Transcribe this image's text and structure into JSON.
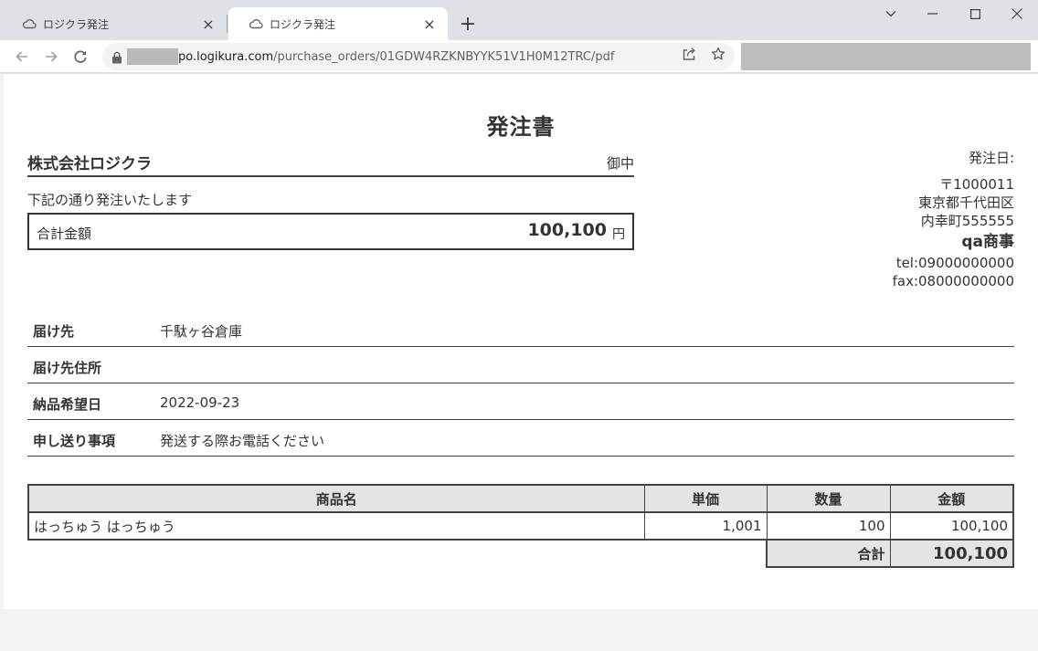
{
  "browser": {
    "tabs": [
      {
        "title": "ロジクラ発注",
        "close": "×"
      },
      {
        "title": "ロジクラ発注",
        "close": "×"
      }
    ],
    "new_tab": "+",
    "url_host": "po.logikura.com",
    "url_path": "/purchase_orders/01GDW4RZKNBYYK51V1H0M12TRC/pdf",
    "icons": {
      "tab": "cloud-icon",
      "back": "back-arrow-icon",
      "forward": "forward-arrow-icon",
      "reload": "reload-icon",
      "lock": "lock-icon",
      "share": "share-icon",
      "bookmark": "star-icon"
    }
  },
  "document": {
    "title": "発注書",
    "addressee": {
      "company": "株式会社ロジクラ",
      "honorific": "御中"
    },
    "intro": "下記の通り発注いたします",
    "total": {
      "label": "合計金額",
      "amount": "100,100",
      "unit": "円"
    },
    "issuer": {
      "order_date_label": "発注日:",
      "postal": "〒1000011",
      "address1": "東京都千代田区",
      "address2": "内幸町555555",
      "name": "qa商事",
      "tel": "tel:09000000000",
      "fax": "fax:08000000000"
    },
    "info": [
      {
        "label": "届け先",
        "value": "千駄ヶ谷倉庫"
      },
      {
        "label": "届け先住所",
        "value": ""
      },
      {
        "label": "納品希望日",
        "value": "2022-09-23"
      },
      {
        "label": "申し送り事項",
        "value": "発送する際お電話ください"
      }
    ],
    "items_table": {
      "headers": [
        "商品名",
        "単価",
        "数量",
        "金額"
      ],
      "rows": [
        {
          "name": "はっちゅう はっちゅう",
          "unit_price": "1,001",
          "quantity": "100",
          "amount": "100,100"
        }
      ],
      "sum_label": "合計",
      "sum_value": "100,100"
    }
  }
}
